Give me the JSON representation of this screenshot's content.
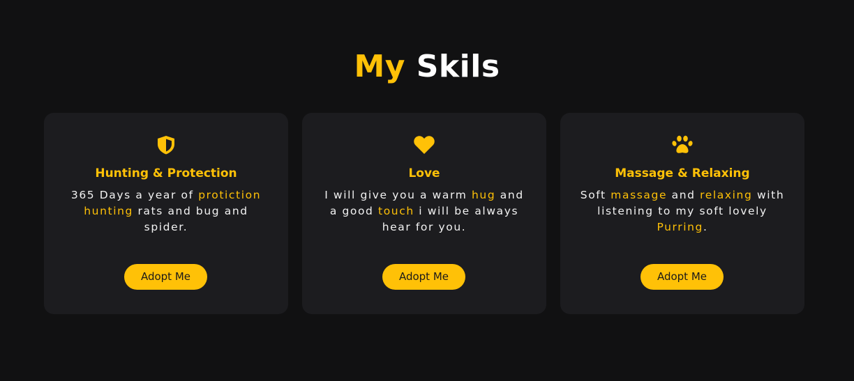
{
  "header": {
    "title_accent": "My",
    "title_rest": "Skils"
  },
  "colors": {
    "background": "#111112",
    "card": "#1c1c1f",
    "accent": "#ffc107",
    "text": "#ffffff"
  },
  "cards": [
    {
      "icon": "shield-icon",
      "title": "Hunting & Protection",
      "text": [
        {
          "t": "365 Days a year of ",
          "hl": false
        },
        {
          "t": "protiction hunting",
          "hl": true
        },
        {
          "t": " rats and bug and spider.",
          "hl": false
        }
      ],
      "button_label": "Adopt Me"
    },
    {
      "icon": "heart-icon",
      "title": "Love",
      "text": [
        {
          "t": "I will give you a warm ",
          "hl": false
        },
        {
          "t": "hug",
          "hl": true
        },
        {
          "t": " and a good ",
          "hl": false
        },
        {
          "t": "touch",
          "hl": true
        },
        {
          "t": " i will be always hear for you.",
          "hl": false
        }
      ],
      "button_label": "Adopt Me"
    },
    {
      "icon": "paw-icon",
      "title": "Massage & Relaxing",
      "text": [
        {
          "t": "Soft ",
          "hl": false
        },
        {
          "t": "massage",
          "hl": true
        },
        {
          "t": " and ",
          "hl": false
        },
        {
          "t": "relaxing",
          "hl": true
        },
        {
          "t": " with listening to my soft lovely ",
          "hl": false
        },
        {
          "t": "Purring",
          "hl": true
        },
        {
          "t": ".",
          "hl": false
        }
      ],
      "button_label": "Adopt Me"
    }
  ]
}
